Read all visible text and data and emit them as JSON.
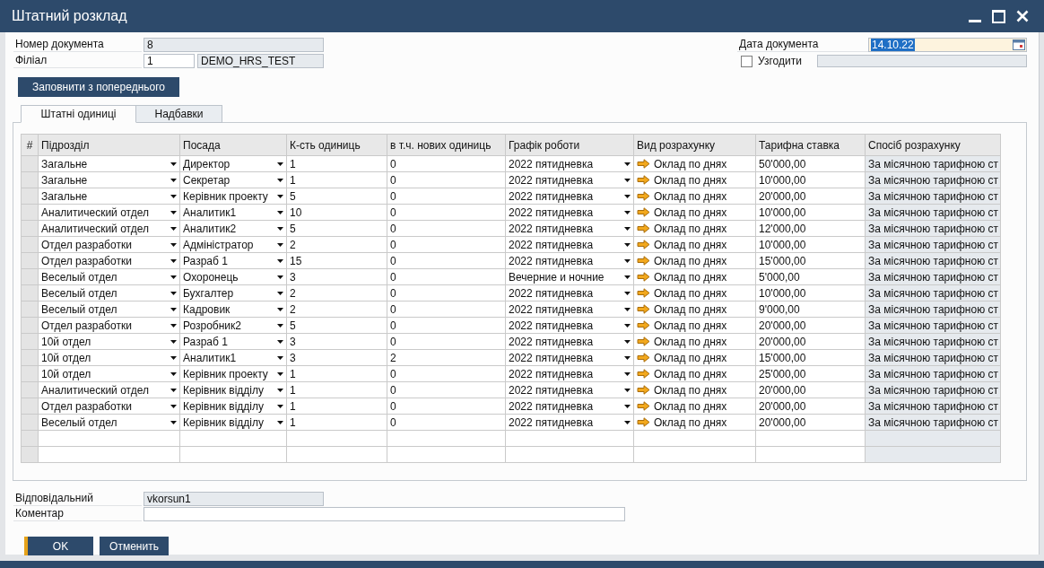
{
  "window": {
    "title": "Штатний розклад"
  },
  "header": {
    "document_number": {
      "label": "Номер документа",
      "value": "8",
      "read_only": true
    },
    "branch": {
      "label": "Філіал",
      "code": {
        "value": "1",
        "read_only": false
      },
      "name": {
        "value": "DEMO_HRS_TEST",
        "read_only": true
      }
    },
    "document_date": {
      "label": "Дата документа",
      "value": "14.10.22",
      "focused": true,
      "text_selected": true
    },
    "approve": {
      "label": "Узгодити",
      "checked": false,
      "read_only": true
    }
  },
  "fill_button": {
    "label": "Заповнити з попереднього"
  },
  "tabs": [
    {
      "label": "Штатні одиниці",
      "selected": true
    },
    {
      "label": "Надбавки",
      "selected": false
    }
  ],
  "table": {
    "columns": [
      {
        "label": "#",
        "kind": "index"
      },
      {
        "label": "Підрозділ",
        "kind": "dropdown"
      },
      {
        "label": "Посада",
        "kind": "dropdown"
      },
      {
        "label": "К-сть одиниць",
        "kind": "text"
      },
      {
        "label": "в т.ч. нових одиниць",
        "kind": "text"
      },
      {
        "label": "Графік роботи",
        "kind": "dropdown"
      },
      {
        "label": "Вид розрахунку",
        "kind": "link"
      },
      {
        "label": "Тарифна ставка",
        "kind": "text"
      },
      {
        "label": "Спосіб розрахунку",
        "kind": "read_only"
      }
    ],
    "rows": [
      {
        "kind": "entry",
        "cells": [
          "Загальне",
          "Директор",
          "1",
          "0",
          "2022 пятидневка",
          "Оклад по днях",
          "50'000,00",
          "За місячною тарифною ст"
        ]
      },
      {
        "kind": "entry",
        "cells": [
          "Загальне",
          "Секретар",
          "1",
          "0",
          "2022 пятидневка",
          "Оклад по днях",
          "10'000,00",
          "За місячною тарифною ст"
        ]
      },
      {
        "kind": "entry",
        "cells": [
          "Загальне",
          "Керівник проекту",
          "5",
          "0",
          "2022 пятидневка",
          "Оклад по днях",
          "20'000,00",
          "За місячною тарифною ст"
        ]
      },
      {
        "kind": "entry",
        "cells": [
          "Аналитический отдел",
          "Аналитик1",
          "10",
          "0",
          "2022 пятидневка",
          "Оклад по днях",
          "10'000,00",
          "За місячною тарифною ст"
        ]
      },
      {
        "kind": "entry",
        "cells": [
          "Аналитический отдел",
          "Аналитик2",
          "5",
          "0",
          "2022 пятидневка",
          "Оклад по днях",
          "12'000,00",
          "За місячною тарифною ст"
        ]
      },
      {
        "kind": "entry",
        "cells": [
          "Отдел разработки",
          "Адміністратор",
          "2",
          "0",
          "2022 пятидневка",
          "Оклад по днях",
          "10'000,00",
          "За місячною тарифною ст"
        ]
      },
      {
        "kind": "entry",
        "cells": [
          "Отдел разработки",
          "Разраб 1",
          "15",
          "0",
          "2022 пятидневка",
          "Оклад по днях",
          "15'000,00",
          "За місячною тарифною ст"
        ]
      },
      {
        "kind": "entry",
        "cells": [
          "Веселый отдел",
          "Охоронець",
          "3",
          "0",
          "Вечерние и ночние",
          "Оклад по днях",
          "5'000,00",
          "За місячною тарифною ст"
        ]
      },
      {
        "kind": "entry",
        "cells": [
          "Веселый отдел",
          "Бухгалтер",
          "2",
          "0",
          "2022 пятидневка",
          "Оклад по днях",
          "10'000,00",
          "За місячною тарифною ст"
        ]
      },
      {
        "kind": "entry",
        "cells": [
          "Веселый отдел",
          "Кадровик",
          "2",
          "0",
          "2022 пятидневка",
          "Оклад по днях",
          "9'000,00",
          "За місячною тарифною ст"
        ]
      },
      {
        "kind": "entry",
        "cells": [
          "Отдел разработки",
          "Розробник2",
          "5",
          "0",
          "2022 пятидневка",
          "Оклад по днях",
          "20'000,00",
          "За місячною тарифною ст"
        ]
      },
      {
        "kind": "entry",
        "cells": [
          "10й отдел",
          "Разраб 1",
          "3",
          "0",
          "2022 пятидневка",
          "Оклад по днях",
          "20'000,00",
          "За місячною тарифною ст"
        ]
      },
      {
        "kind": "entry",
        "cells": [
          "10й отдел",
          "Аналитик1",
          "3",
          "2",
          "2022 пятидневка",
          "Оклад по днях",
          "15'000,00",
          "За місячною тарифною ст"
        ]
      },
      {
        "kind": "entry",
        "cells": [
          "10й отдел",
          "Керівник проекту",
          "1",
          "0",
          "2022 пятидневка",
          "Оклад по днях",
          "25'000,00",
          "За місячною тарифною ст"
        ]
      },
      {
        "kind": "entry",
        "cells": [
          "Аналитический отдел",
          "Керівник відділу",
          "1",
          "0",
          "2022 пятидневка",
          "Оклад по днях",
          "20'000,00",
          "За місячною тарифною ст"
        ]
      },
      {
        "kind": "entry",
        "cells": [
          "Отдел разработки",
          "Керівник відділу",
          "1",
          "0",
          "2022 пятидневка",
          "Оклад по днях",
          "20'000,00",
          "За місячною тарифною ст"
        ]
      },
      {
        "kind": "entry",
        "cells": [
          "Веселый отдел",
          "Керівник відділу",
          "1",
          "0",
          "2022 пятидневка",
          "Оклад по днях",
          "20'000,00",
          "За місячною тарифною ст"
        ]
      },
      {
        "kind": "blank"
      },
      {
        "kind": "blank"
      }
    ]
  },
  "footer": {
    "responsible": {
      "label": "Відповідальний",
      "value": "vkorsun1",
      "read_only": true
    },
    "comment": {
      "label": "Коментар",
      "read_only": false
    }
  },
  "buttons": [
    {
      "label": "OK",
      "default": true
    },
    {
      "label": "Отменить",
      "default": false
    }
  ]
}
